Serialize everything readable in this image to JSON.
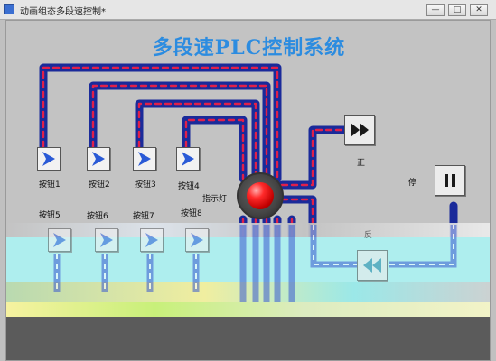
{
  "window": {
    "title": "动画组态多段速控制*",
    "buttons": {
      "minimize": "—",
      "maximize": "□",
      "close": "✕"
    }
  },
  "heading": "多段速PLC控制系统",
  "buttons": [
    {
      "label": "按钮1"
    },
    {
      "label": "按钮2"
    },
    {
      "label": "按钮3"
    },
    {
      "label": "按钮4"
    },
    {
      "label": "按钮5"
    },
    {
      "label": "按钮6"
    },
    {
      "label": "按钮7"
    },
    {
      "label": "按钮8"
    }
  ],
  "indicator": {
    "label": "指示灯"
  },
  "controls": {
    "forward_label": "正",
    "stop_label": "停",
    "reverse_label": "反"
  },
  "colors": {
    "heading": "#2c8ce0",
    "pipe_outer": "#1a2a9a",
    "pipe_dash": "#e0204a",
    "button_arrow": "#2a5ad6",
    "control_glyph": "#1a1a1a"
  },
  "icons": {
    "button_arrow": "play-arrow-icon",
    "forward": "fast-forward-icon",
    "stop": "pause-icon",
    "reverse": "rewind-icon",
    "lamp": "indicator-lamp-icon"
  }
}
